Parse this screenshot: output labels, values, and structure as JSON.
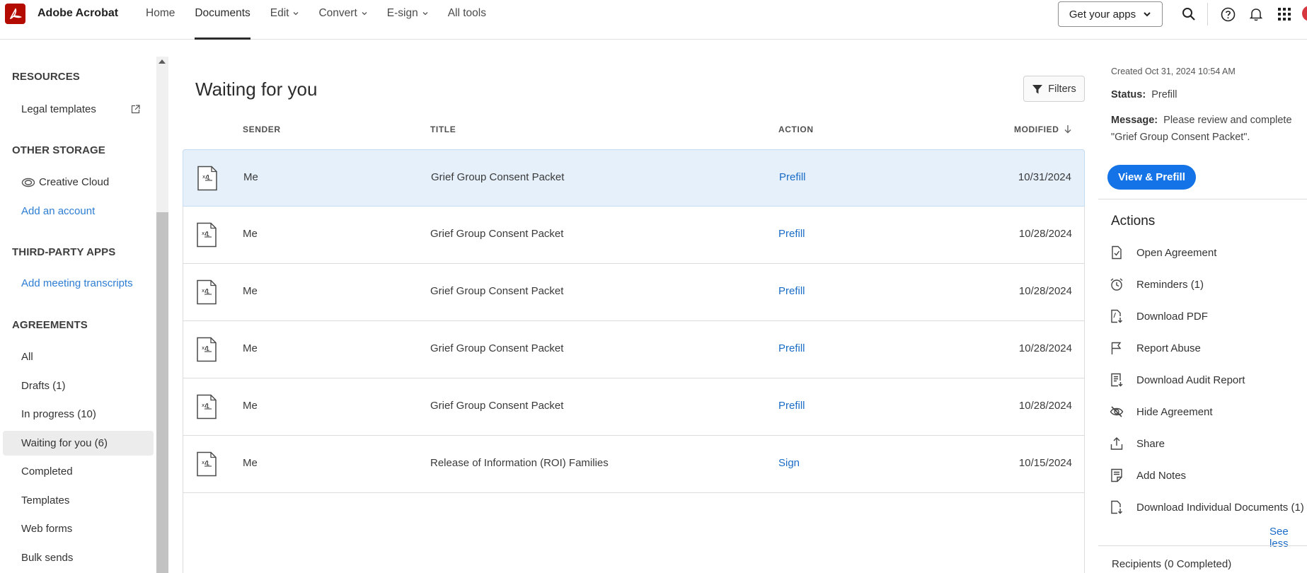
{
  "header": {
    "app_name": "Adobe Acrobat",
    "nav": [
      "Home",
      "Documents",
      "Edit",
      "Convert",
      "E-sign",
      "All tools"
    ],
    "active_nav": "Documents",
    "get_apps": "Get your apps"
  },
  "sidebar": {
    "resources_title": "RESOURCES",
    "legal_templates": "Legal templates",
    "other_storage_title": "OTHER STORAGE",
    "creative_cloud": "Creative Cloud",
    "add_account": "Add an account",
    "third_party_title": "THIRD-PARTY APPS",
    "add_meeting": "Add meeting transcripts",
    "agreements_title": "AGREEMENTS",
    "agreements": [
      "All",
      "Drafts (1)",
      "In progress (10)",
      "Waiting for you (6)",
      "Completed",
      "Templates",
      "Web forms",
      "Bulk sends"
    ],
    "active_agreement": "Waiting for you (6)"
  },
  "main": {
    "title": "Waiting for you",
    "filters": "Filters",
    "columns": {
      "sender": "SENDER",
      "title": "TITLE",
      "action": "ACTION",
      "modified": "MODIFIED"
    },
    "rows": [
      {
        "sender": "Me",
        "title": "Grief Group Consent Packet",
        "action": "Prefill",
        "modified": "10/31/2024",
        "selected": true
      },
      {
        "sender": "Me",
        "title": "Grief Group Consent Packet",
        "action": "Prefill",
        "modified": "10/28/2024"
      },
      {
        "sender": "Me",
        "title": "Grief Group Consent Packet",
        "action": "Prefill",
        "modified": "10/28/2024"
      },
      {
        "sender": "Me",
        "title": "Grief Group Consent Packet",
        "action": "Prefill",
        "modified": "10/28/2024"
      },
      {
        "sender": "Me",
        "title": "Grief Group Consent Packet",
        "action": "Prefill",
        "modified": "10/28/2024"
      },
      {
        "sender": "Me",
        "title": "Release of Information (ROI) Families",
        "action": "Sign",
        "modified": "10/15/2024"
      }
    ]
  },
  "panel": {
    "created": "Created Oct 31, 2024 10:54 AM",
    "status_label": "Status:",
    "status_value": "Prefill",
    "message_label": "Message:",
    "message_value": "Please review and complete",
    "message_value_2": "\"Grief Group Consent Packet\".",
    "view_button": "View & Prefill",
    "actions_title": "Actions",
    "actions": [
      {
        "label": "Open Agreement",
        "icon": "open-agreement-icon"
      },
      {
        "label": "Reminders (1)",
        "icon": "alarm-clock-icon"
      },
      {
        "label": "Download PDF",
        "icon": "download-pdf-icon"
      },
      {
        "label": "Report Abuse",
        "icon": "flag-icon"
      },
      {
        "label": "Download Audit Report",
        "icon": "audit-report-icon"
      },
      {
        "label": "Hide Agreement",
        "icon": "eye-hidden-icon"
      },
      {
        "label": "Share",
        "icon": "share-icon"
      },
      {
        "label": "Add Notes",
        "icon": "notes-icon"
      },
      {
        "label": "Download Individual Documents (1)",
        "icon": "download-documents-icon"
      }
    ],
    "see_less": "See less",
    "recipients": "Recipients (0 Completed)"
  },
  "colors": {
    "brand": "#b30b00",
    "accent": "#1473e6",
    "link": "#1a6cc6",
    "selected_row": "#e5f0fb"
  }
}
